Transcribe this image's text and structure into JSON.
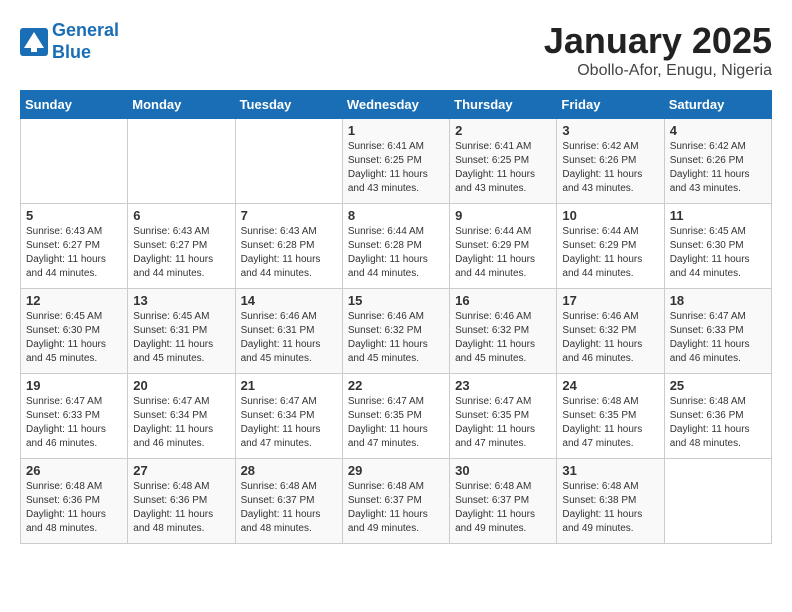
{
  "header": {
    "logo_line1": "General",
    "logo_line2": "Blue",
    "title": "January 2025",
    "subtitle": "Obollo-Afor, Enugu, Nigeria"
  },
  "weekdays": [
    "Sunday",
    "Monday",
    "Tuesday",
    "Wednesday",
    "Thursday",
    "Friday",
    "Saturday"
  ],
  "weeks": [
    [
      {
        "day": "",
        "sunrise": "",
        "sunset": "",
        "daylight": ""
      },
      {
        "day": "",
        "sunrise": "",
        "sunset": "",
        "daylight": ""
      },
      {
        "day": "",
        "sunrise": "",
        "sunset": "",
        "daylight": ""
      },
      {
        "day": "1",
        "sunrise": "Sunrise: 6:41 AM",
        "sunset": "Sunset: 6:25 PM",
        "daylight": "Daylight: 11 hours and 43 minutes."
      },
      {
        "day": "2",
        "sunrise": "Sunrise: 6:41 AM",
        "sunset": "Sunset: 6:25 PM",
        "daylight": "Daylight: 11 hours and 43 minutes."
      },
      {
        "day": "3",
        "sunrise": "Sunrise: 6:42 AM",
        "sunset": "Sunset: 6:26 PM",
        "daylight": "Daylight: 11 hours and 43 minutes."
      },
      {
        "day": "4",
        "sunrise": "Sunrise: 6:42 AM",
        "sunset": "Sunset: 6:26 PM",
        "daylight": "Daylight: 11 hours and 43 minutes."
      }
    ],
    [
      {
        "day": "5",
        "sunrise": "Sunrise: 6:43 AM",
        "sunset": "Sunset: 6:27 PM",
        "daylight": "Daylight: 11 hours and 44 minutes."
      },
      {
        "day": "6",
        "sunrise": "Sunrise: 6:43 AM",
        "sunset": "Sunset: 6:27 PM",
        "daylight": "Daylight: 11 hours and 44 minutes."
      },
      {
        "day": "7",
        "sunrise": "Sunrise: 6:43 AM",
        "sunset": "Sunset: 6:28 PM",
        "daylight": "Daylight: 11 hours and 44 minutes."
      },
      {
        "day": "8",
        "sunrise": "Sunrise: 6:44 AM",
        "sunset": "Sunset: 6:28 PM",
        "daylight": "Daylight: 11 hours and 44 minutes."
      },
      {
        "day": "9",
        "sunrise": "Sunrise: 6:44 AM",
        "sunset": "Sunset: 6:29 PM",
        "daylight": "Daylight: 11 hours and 44 minutes."
      },
      {
        "day": "10",
        "sunrise": "Sunrise: 6:44 AM",
        "sunset": "Sunset: 6:29 PM",
        "daylight": "Daylight: 11 hours and 44 minutes."
      },
      {
        "day": "11",
        "sunrise": "Sunrise: 6:45 AM",
        "sunset": "Sunset: 6:30 PM",
        "daylight": "Daylight: 11 hours and 44 minutes."
      }
    ],
    [
      {
        "day": "12",
        "sunrise": "Sunrise: 6:45 AM",
        "sunset": "Sunset: 6:30 PM",
        "daylight": "Daylight: 11 hours and 45 minutes."
      },
      {
        "day": "13",
        "sunrise": "Sunrise: 6:45 AM",
        "sunset": "Sunset: 6:31 PM",
        "daylight": "Daylight: 11 hours and 45 minutes."
      },
      {
        "day": "14",
        "sunrise": "Sunrise: 6:46 AM",
        "sunset": "Sunset: 6:31 PM",
        "daylight": "Daylight: 11 hours and 45 minutes."
      },
      {
        "day": "15",
        "sunrise": "Sunrise: 6:46 AM",
        "sunset": "Sunset: 6:32 PM",
        "daylight": "Daylight: 11 hours and 45 minutes."
      },
      {
        "day": "16",
        "sunrise": "Sunrise: 6:46 AM",
        "sunset": "Sunset: 6:32 PM",
        "daylight": "Daylight: 11 hours and 45 minutes."
      },
      {
        "day": "17",
        "sunrise": "Sunrise: 6:46 AM",
        "sunset": "Sunset: 6:32 PM",
        "daylight": "Daylight: 11 hours and 46 minutes."
      },
      {
        "day": "18",
        "sunrise": "Sunrise: 6:47 AM",
        "sunset": "Sunset: 6:33 PM",
        "daylight": "Daylight: 11 hours and 46 minutes."
      }
    ],
    [
      {
        "day": "19",
        "sunrise": "Sunrise: 6:47 AM",
        "sunset": "Sunset: 6:33 PM",
        "daylight": "Daylight: 11 hours and 46 minutes."
      },
      {
        "day": "20",
        "sunrise": "Sunrise: 6:47 AM",
        "sunset": "Sunset: 6:34 PM",
        "daylight": "Daylight: 11 hours and 46 minutes."
      },
      {
        "day": "21",
        "sunrise": "Sunrise: 6:47 AM",
        "sunset": "Sunset: 6:34 PM",
        "daylight": "Daylight: 11 hours and 47 minutes."
      },
      {
        "day": "22",
        "sunrise": "Sunrise: 6:47 AM",
        "sunset": "Sunset: 6:35 PM",
        "daylight": "Daylight: 11 hours and 47 minutes."
      },
      {
        "day": "23",
        "sunrise": "Sunrise: 6:47 AM",
        "sunset": "Sunset: 6:35 PM",
        "daylight": "Daylight: 11 hours and 47 minutes."
      },
      {
        "day": "24",
        "sunrise": "Sunrise: 6:48 AM",
        "sunset": "Sunset: 6:35 PM",
        "daylight": "Daylight: 11 hours and 47 minutes."
      },
      {
        "day": "25",
        "sunrise": "Sunrise: 6:48 AM",
        "sunset": "Sunset: 6:36 PM",
        "daylight": "Daylight: 11 hours and 48 minutes."
      }
    ],
    [
      {
        "day": "26",
        "sunrise": "Sunrise: 6:48 AM",
        "sunset": "Sunset: 6:36 PM",
        "daylight": "Daylight: 11 hours and 48 minutes."
      },
      {
        "day": "27",
        "sunrise": "Sunrise: 6:48 AM",
        "sunset": "Sunset: 6:36 PM",
        "daylight": "Daylight: 11 hours and 48 minutes."
      },
      {
        "day": "28",
        "sunrise": "Sunrise: 6:48 AM",
        "sunset": "Sunset: 6:37 PM",
        "daylight": "Daylight: 11 hours and 48 minutes."
      },
      {
        "day": "29",
        "sunrise": "Sunrise: 6:48 AM",
        "sunset": "Sunset: 6:37 PM",
        "daylight": "Daylight: 11 hours and 49 minutes."
      },
      {
        "day": "30",
        "sunrise": "Sunrise: 6:48 AM",
        "sunset": "Sunset: 6:37 PM",
        "daylight": "Daylight: 11 hours and 49 minutes."
      },
      {
        "day": "31",
        "sunrise": "Sunrise: 6:48 AM",
        "sunset": "Sunset: 6:38 PM",
        "daylight": "Daylight: 11 hours and 49 minutes."
      },
      {
        "day": "",
        "sunrise": "",
        "sunset": "",
        "daylight": ""
      }
    ]
  ]
}
